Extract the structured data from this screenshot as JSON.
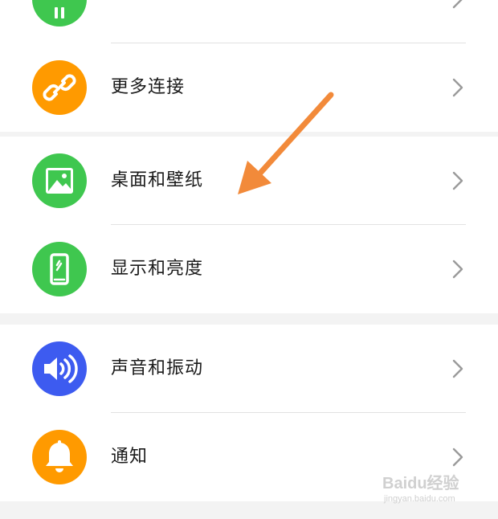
{
  "settings": {
    "rows": [
      {
        "label": "",
        "icon": "partial-green-icon",
        "color": "#3fc74f"
      },
      {
        "label": "更多连接",
        "icon": "link-icon",
        "color": "#ff9a00"
      },
      {
        "label": "桌面和壁纸",
        "icon": "image-icon",
        "color": "#3fc74f"
      },
      {
        "label": "显示和亮度",
        "icon": "phone-brightness-icon",
        "color": "#3fc74f"
      },
      {
        "label": "声音和振动",
        "icon": "speaker-icon",
        "color": "#3d5bf0"
      },
      {
        "label": "通知",
        "icon": "bell-icon",
        "color": "#ff9a00"
      }
    ]
  },
  "annotation": {
    "arrow_color": "#f28a3a"
  },
  "watermark": {
    "brand": "Baidu经验",
    "site": "jingyan.baidu.com"
  }
}
